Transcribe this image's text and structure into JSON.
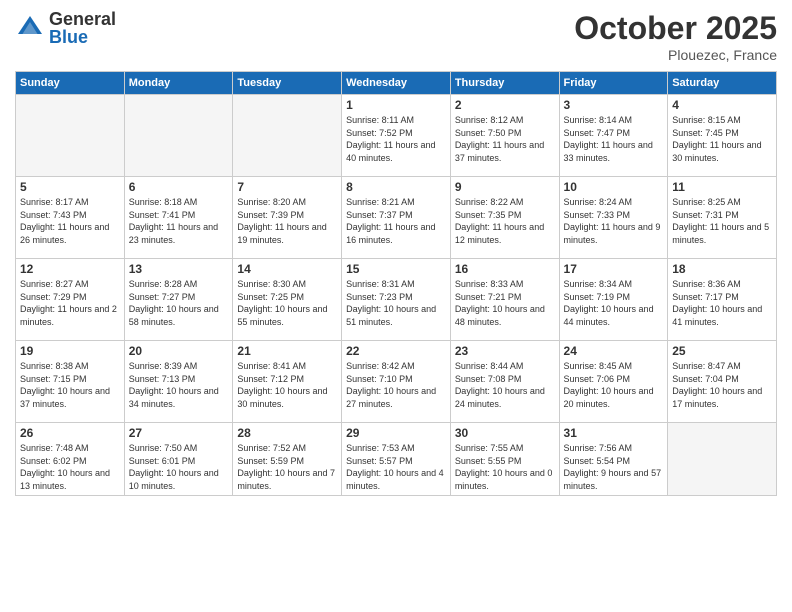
{
  "header": {
    "logo_general": "General",
    "logo_blue": "Blue",
    "month_title": "October 2025",
    "location": "Plouezec, France"
  },
  "weekdays": [
    "Sunday",
    "Monday",
    "Tuesday",
    "Wednesday",
    "Thursday",
    "Friday",
    "Saturday"
  ],
  "days": [
    {
      "date": "",
      "sunrise": "",
      "sunset": "",
      "daylight": "",
      "empty": true
    },
    {
      "date": "",
      "sunrise": "",
      "sunset": "",
      "daylight": "",
      "empty": true
    },
    {
      "date": "",
      "sunrise": "",
      "sunset": "",
      "daylight": "",
      "empty": true
    },
    {
      "date": "1",
      "sunrise": "Sunrise: 8:11 AM",
      "sunset": "Sunset: 7:52 PM",
      "daylight": "Daylight: 11 hours and 40 minutes."
    },
    {
      "date": "2",
      "sunrise": "Sunrise: 8:12 AM",
      "sunset": "Sunset: 7:50 PM",
      "daylight": "Daylight: 11 hours and 37 minutes."
    },
    {
      "date": "3",
      "sunrise": "Sunrise: 8:14 AM",
      "sunset": "Sunset: 7:47 PM",
      "daylight": "Daylight: 11 hours and 33 minutes."
    },
    {
      "date": "4",
      "sunrise": "Sunrise: 8:15 AM",
      "sunset": "Sunset: 7:45 PM",
      "daylight": "Daylight: 11 hours and 30 minutes."
    },
    {
      "date": "5",
      "sunrise": "Sunrise: 8:17 AM",
      "sunset": "Sunset: 7:43 PM",
      "daylight": "Daylight: 11 hours and 26 minutes."
    },
    {
      "date": "6",
      "sunrise": "Sunrise: 8:18 AM",
      "sunset": "Sunset: 7:41 PM",
      "daylight": "Daylight: 11 hours and 23 minutes."
    },
    {
      "date": "7",
      "sunrise": "Sunrise: 8:20 AM",
      "sunset": "Sunset: 7:39 PM",
      "daylight": "Daylight: 11 hours and 19 minutes."
    },
    {
      "date": "8",
      "sunrise": "Sunrise: 8:21 AM",
      "sunset": "Sunset: 7:37 PM",
      "daylight": "Daylight: 11 hours and 16 minutes."
    },
    {
      "date": "9",
      "sunrise": "Sunrise: 8:22 AM",
      "sunset": "Sunset: 7:35 PM",
      "daylight": "Daylight: 11 hours and 12 minutes."
    },
    {
      "date": "10",
      "sunrise": "Sunrise: 8:24 AM",
      "sunset": "Sunset: 7:33 PM",
      "daylight": "Daylight: 11 hours and 9 minutes."
    },
    {
      "date": "11",
      "sunrise": "Sunrise: 8:25 AM",
      "sunset": "Sunset: 7:31 PM",
      "daylight": "Daylight: 11 hours and 5 minutes."
    },
    {
      "date": "12",
      "sunrise": "Sunrise: 8:27 AM",
      "sunset": "Sunset: 7:29 PM",
      "daylight": "Daylight: 11 hours and 2 minutes."
    },
    {
      "date": "13",
      "sunrise": "Sunrise: 8:28 AM",
      "sunset": "Sunset: 7:27 PM",
      "daylight": "Daylight: 10 hours and 58 minutes."
    },
    {
      "date": "14",
      "sunrise": "Sunrise: 8:30 AM",
      "sunset": "Sunset: 7:25 PM",
      "daylight": "Daylight: 10 hours and 55 minutes."
    },
    {
      "date": "15",
      "sunrise": "Sunrise: 8:31 AM",
      "sunset": "Sunset: 7:23 PM",
      "daylight": "Daylight: 10 hours and 51 minutes."
    },
    {
      "date": "16",
      "sunrise": "Sunrise: 8:33 AM",
      "sunset": "Sunset: 7:21 PM",
      "daylight": "Daylight: 10 hours and 48 minutes."
    },
    {
      "date": "17",
      "sunrise": "Sunrise: 8:34 AM",
      "sunset": "Sunset: 7:19 PM",
      "daylight": "Daylight: 10 hours and 44 minutes."
    },
    {
      "date": "18",
      "sunrise": "Sunrise: 8:36 AM",
      "sunset": "Sunset: 7:17 PM",
      "daylight": "Daylight: 10 hours and 41 minutes."
    },
    {
      "date": "19",
      "sunrise": "Sunrise: 8:38 AM",
      "sunset": "Sunset: 7:15 PM",
      "daylight": "Daylight: 10 hours and 37 minutes."
    },
    {
      "date": "20",
      "sunrise": "Sunrise: 8:39 AM",
      "sunset": "Sunset: 7:13 PM",
      "daylight": "Daylight: 10 hours and 34 minutes."
    },
    {
      "date": "21",
      "sunrise": "Sunrise: 8:41 AM",
      "sunset": "Sunset: 7:12 PM",
      "daylight": "Daylight: 10 hours and 30 minutes."
    },
    {
      "date": "22",
      "sunrise": "Sunrise: 8:42 AM",
      "sunset": "Sunset: 7:10 PM",
      "daylight": "Daylight: 10 hours and 27 minutes."
    },
    {
      "date": "23",
      "sunrise": "Sunrise: 8:44 AM",
      "sunset": "Sunset: 7:08 PM",
      "daylight": "Daylight: 10 hours and 24 minutes."
    },
    {
      "date": "24",
      "sunrise": "Sunrise: 8:45 AM",
      "sunset": "Sunset: 7:06 PM",
      "daylight": "Daylight: 10 hours and 20 minutes."
    },
    {
      "date": "25",
      "sunrise": "Sunrise: 8:47 AM",
      "sunset": "Sunset: 7:04 PM",
      "daylight": "Daylight: 10 hours and 17 minutes."
    },
    {
      "date": "26",
      "sunrise": "Sunrise: 7:48 AM",
      "sunset": "Sunset: 6:02 PM",
      "daylight": "Daylight: 10 hours and 13 minutes."
    },
    {
      "date": "27",
      "sunrise": "Sunrise: 7:50 AM",
      "sunset": "Sunset: 6:01 PM",
      "daylight": "Daylight: 10 hours and 10 minutes."
    },
    {
      "date": "28",
      "sunrise": "Sunrise: 7:52 AM",
      "sunset": "Sunset: 5:59 PM",
      "daylight": "Daylight: 10 hours and 7 minutes."
    },
    {
      "date": "29",
      "sunrise": "Sunrise: 7:53 AM",
      "sunset": "Sunset: 5:57 PM",
      "daylight": "Daylight: 10 hours and 4 minutes."
    },
    {
      "date": "30",
      "sunrise": "Sunrise: 7:55 AM",
      "sunset": "Sunset: 5:55 PM",
      "daylight": "Daylight: 10 hours and 0 minutes."
    },
    {
      "date": "31",
      "sunrise": "Sunrise: 7:56 AM",
      "sunset": "Sunset: 5:54 PM",
      "daylight": "Daylight: 9 hours and 57 minutes."
    },
    {
      "date": "",
      "sunrise": "",
      "sunset": "",
      "daylight": "",
      "empty": true
    }
  ]
}
